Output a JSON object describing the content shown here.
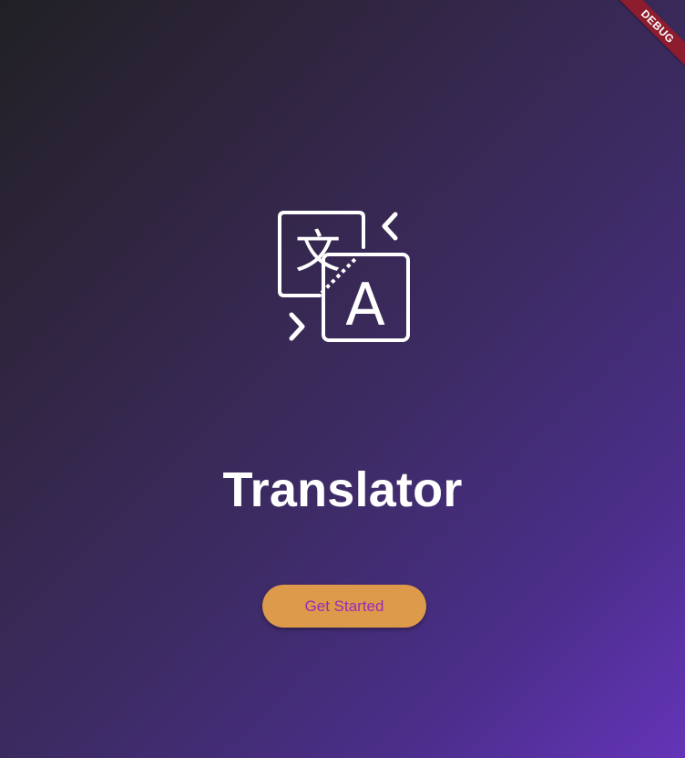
{
  "app": {
    "title": "Translator",
    "logo_icon": "translate-icon",
    "logo_glyphs": {
      "source": "文",
      "target": "A"
    }
  },
  "actions": {
    "get_started_label": "Get Started"
  },
  "debug_banner": {
    "label": "DEBUG"
  },
  "colors": {
    "background_start": "#202024",
    "background_end": "#6434b8",
    "button_background": "#dd9a4a",
    "button_text": "#9b2bb6",
    "title_text": "#ffffff",
    "debug_ribbon": "#8d1c2e"
  }
}
